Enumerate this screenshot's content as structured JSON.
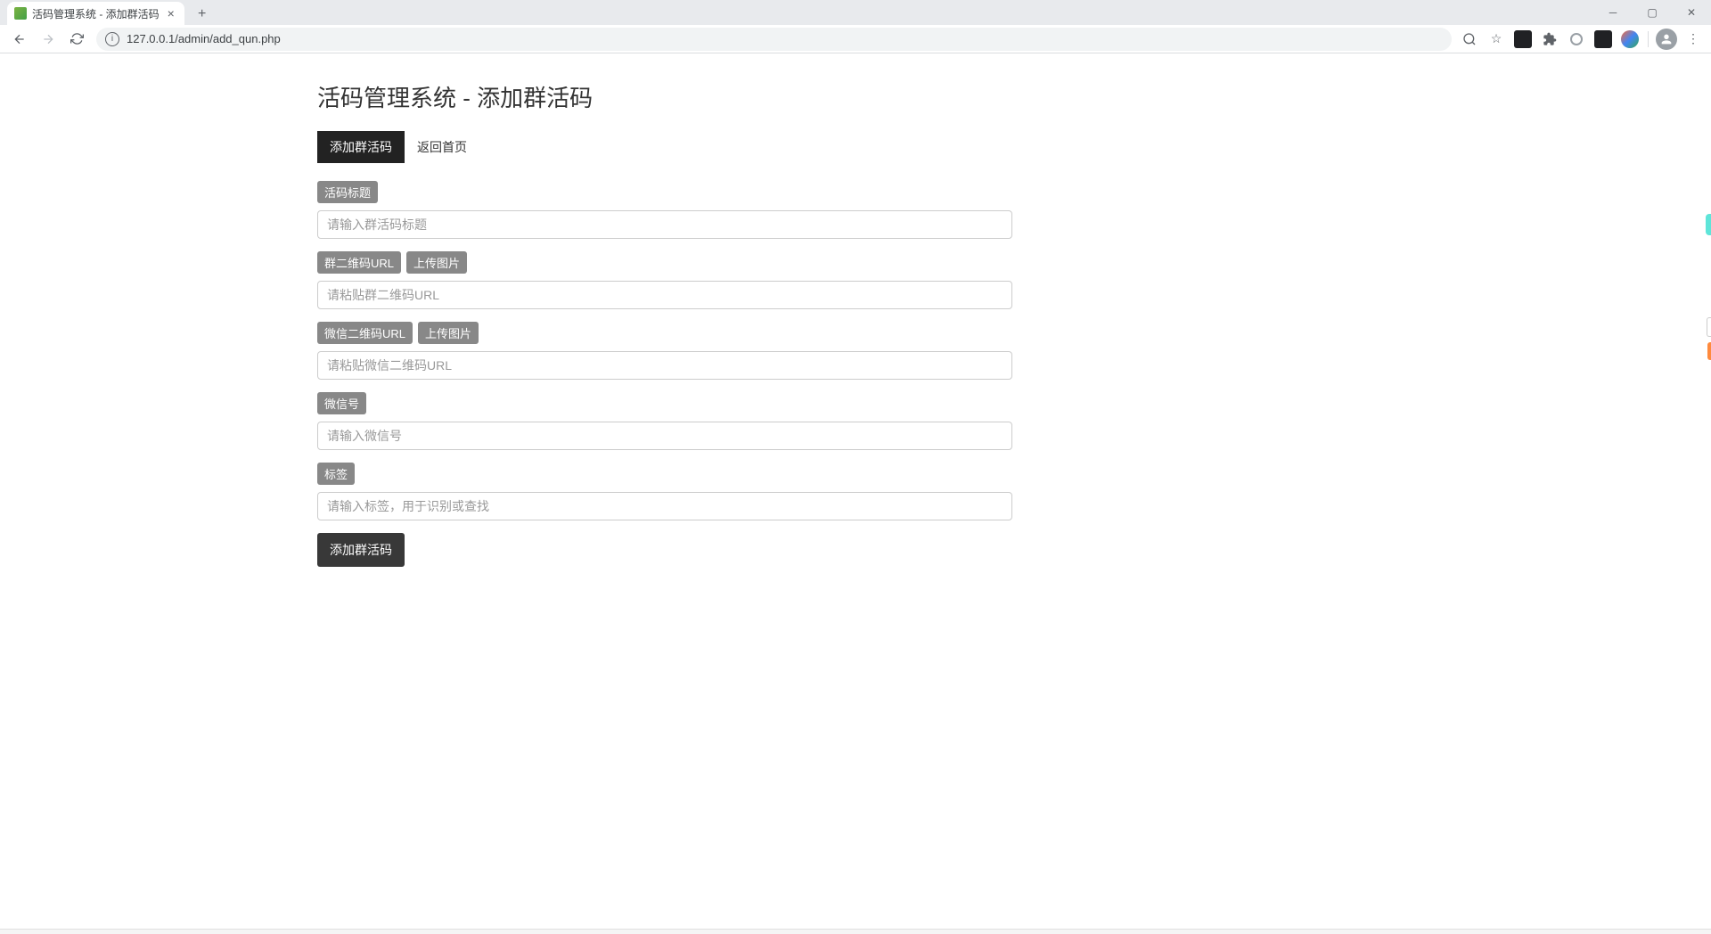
{
  "browser": {
    "tab_title": "活码管理系统 - 添加群活码",
    "url": "127.0.0.1/admin/add_qun.php"
  },
  "page": {
    "title": "活码管理系统 - 添加群活码",
    "tabs": {
      "add": "添加群活码",
      "back": "返回首页"
    },
    "form": {
      "title": {
        "label": "活码标题",
        "placeholder": "请输入群活码标题"
      },
      "qun_url": {
        "label": "群二维码URL",
        "upload_label": "上传图片",
        "placeholder": "请粘贴群二维码URL"
      },
      "wx_url": {
        "label": "微信二维码URL",
        "upload_label": "上传图片",
        "placeholder": "请粘贴微信二维码URL"
      },
      "wx_id": {
        "label": "微信号",
        "placeholder": "请输入微信号"
      },
      "tags": {
        "label": "标签",
        "placeholder": "请输入标签，用于识别或查找"
      },
      "submit": "添加群活码"
    }
  }
}
